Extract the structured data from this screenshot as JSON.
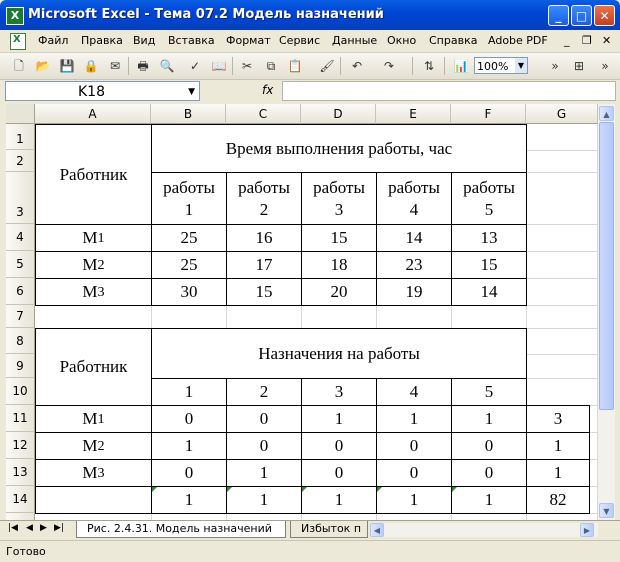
{
  "window": {
    "title": "Microsoft Excel - Тема 07.2 Модель назначений",
    "app_icon": "excel-icon",
    "controls": [
      "minimize-icon",
      "maximize-icon",
      "close-icon"
    ]
  },
  "menu": {
    "items": [
      "Файл",
      "Правка",
      "Вид",
      "Вставка",
      "Формат",
      "Сервис",
      "Данные",
      "Окно",
      "Справка",
      "Adobe PDF"
    ]
  },
  "toolbar": {
    "zoom": "100%",
    "icons": [
      "new-icon",
      "open-icon",
      "save-icon",
      "permission-icon",
      "print-icon",
      "print-preview-icon",
      "spelling-icon",
      "cut-icon",
      "copy-icon",
      "paste-icon",
      "format-painter-icon",
      "undo-icon",
      "redo-icon",
      "sort-icon",
      "chart-icon"
    ]
  },
  "formula_bar": {
    "cell_ref": "K18",
    "fx_label": "fx",
    "formula": ""
  },
  "grid": {
    "columns": [
      "A",
      "B",
      "C",
      "D",
      "E",
      "F",
      "G"
    ],
    "rows": [
      "1",
      "2",
      "3",
      "4",
      "5",
      "6",
      "7",
      "8",
      "9",
      "10",
      "11",
      "12",
      "13",
      "14"
    ]
  },
  "table1": {
    "worker_header": "Работник",
    "title": "Время выполнения работы, час",
    "job_label": "работы",
    "job_numbers": [
      "1",
      "2",
      "3",
      "4",
      "5"
    ],
    "rows": [
      {
        "worker": "M",
        "sub": "1",
        "values": [
          "25",
          "16",
          "15",
          "14",
          "13"
        ]
      },
      {
        "worker": "M",
        "sub": "2",
        "values": [
          "25",
          "17",
          "18",
          "23",
          "15"
        ]
      },
      {
        "worker": "M",
        "sub": "3",
        "values": [
          "30",
          "15",
          "20",
          "19",
          "14"
        ]
      }
    ]
  },
  "table2": {
    "worker_header": "Работник",
    "title": "Назначения на работы",
    "job_numbers": [
      "1",
      "2",
      "3",
      "4",
      "5"
    ],
    "rows": [
      {
        "worker": "M",
        "sub": "1",
        "values": [
          "0",
          "0",
          "1",
          "1",
          "1"
        ],
        "total": "3"
      },
      {
        "worker": "M",
        "sub": "2",
        "values": [
          "1",
          "0",
          "0",
          "0",
          "0"
        ],
        "total": "1"
      },
      {
        "worker": "M",
        "sub": "3",
        "values": [
          "0",
          "1",
          "0",
          "0",
          "0"
        ],
        "total": "1"
      }
    ],
    "totals": [
      "1",
      "1",
      "1",
      "1",
      "1"
    ],
    "grand_total": "82"
  },
  "tabs": {
    "active": "Рис. 2.4.31. Модель назначений",
    "next": "Избыток п"
  },
  "status": {
    "text": "Готово"
  }
}
